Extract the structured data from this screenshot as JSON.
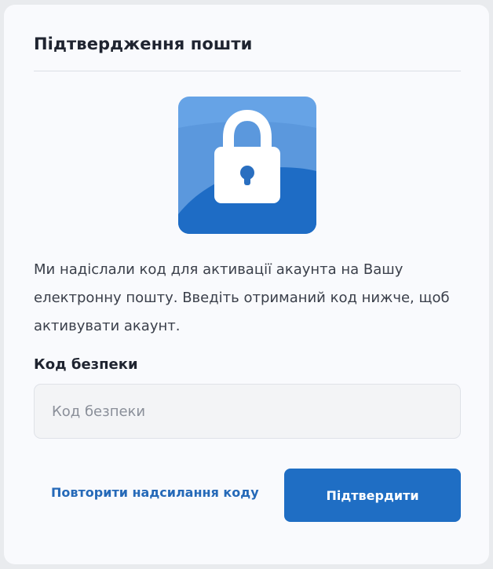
{
  "dialog": {
    "title": "Підтвердження пошти",
    "icon": "lock-icon",
    "message": "Ми надіслали код для активації акаунта на Вашу електронну пошту. Введіть отриманий код нижче, щоб активувати акаунт.",
    "field_label": "Код безпеки",
    "field_placeholder": "Код безпеки",
    "field_value": "",
    "resend_label": "Повторити надсилання коду",
    "confirm_label": "Підтвердити"
  },
  "colors": {
    "accent": "#1f6ec4",
    "link": "#2569b8",
    "tile_light": "#6aa6e8",
    "tile_dark": "#1c6cc6"
  }
}
